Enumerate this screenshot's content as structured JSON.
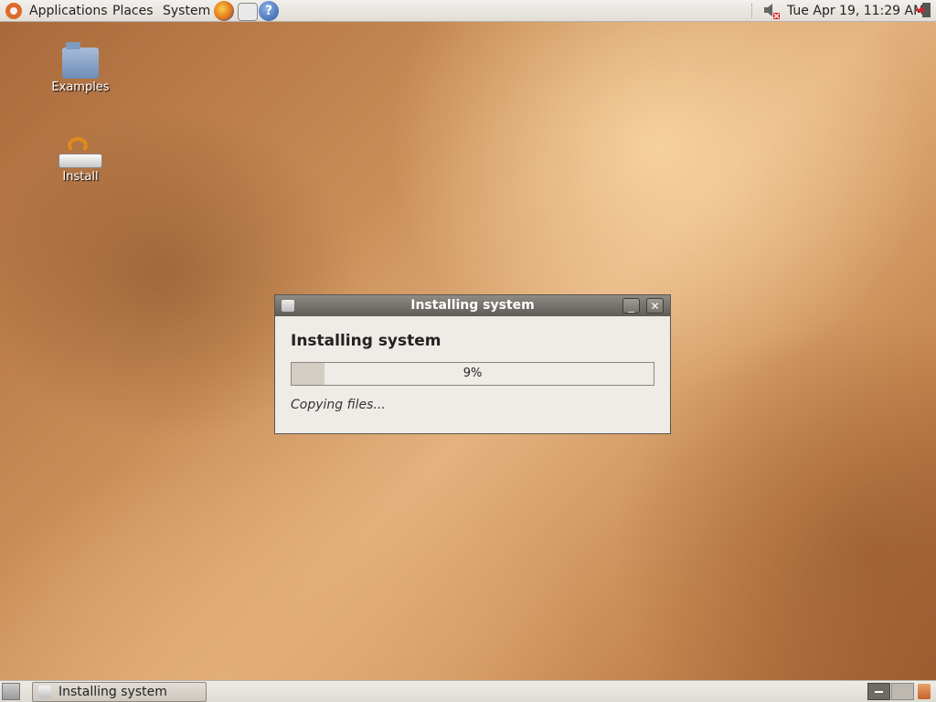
{
  "top_panel": {
    "menus": [
      "Applications",
      "Places",
      "System"
    ],
    "launchers": [
      "firefox-icon",
      "mail-icon",
      "help-icon"
    ],
    "clock": "Tue Apr 19, 11:29 AM",
    "tray_icons": [
      "volume-muted-icon",
      "shutdown-icon"
    ]
  },
  "desktop": {
    "icons": [
      {
        "label": "Examples",
        "icon": "folder-icon"
      },
      {
        "label": "Install",
        "icon": "installer-icon"
      }
    ]
  },
  "window": {
    "title": "Installing system",
    "heading": "Installing system",
    "progress_text": "9%",
    "progress_fraction": 0.09,
    "status": "Copying files...",
    "minimize_label": "_",
    "close_label": "✕"
  },
  "bottom_panel": {
    "task_label": "Installing system"
  },
  "colors": {
    "titlebar": "#6f6b66",
    "panel": "#e9e6e0",
    "desktop_base": "#c98e58"
  }
}
